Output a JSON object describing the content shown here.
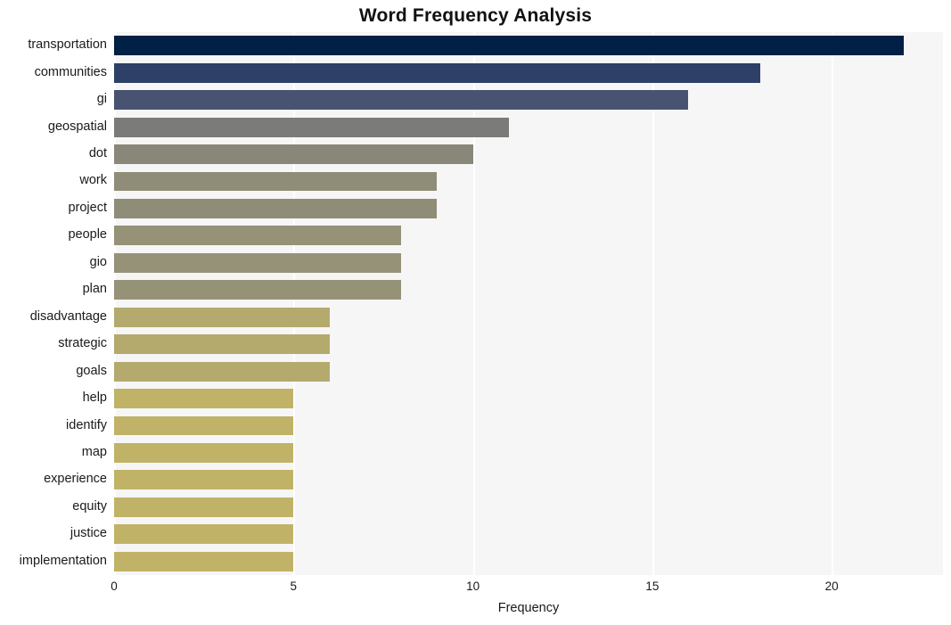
{
  "chart_data": {
    "type": "bar",
    "orientation": "horizontal",
    "title": "Word Frequency Analysis",
    "xlabel": "Frequency",
    "ylabel": "",
    "xlim": [
      0,
      23.1
    ],
    "xticks": [
      0,
      5,
      10,
      15,
      20
    ],
    "xticklabels": [
      "0",
      "5",
      "10",
      "15",
      "20"
    ],
    "grid": true,
    "grid_axis": "x",
    "grid_color": "#ffffff",
    "plot_background": "#f6f6f7",
    "legend": "none",
    "categories": [
      "transportation",
      "communities",
      "gi",
      "geospatial",
      "dot",
      "work",
      "project",
      "people",
      "gio",
      "plan",
      "disadvantage",
      "strategic",
      "goals",
      "help",
      "identify",
      "map",
      "experience",
      "equity",
      "justice",
      "implementation"
    ],
    "values": [
      22,
      18,
      16,
      11,
      10,
      9,
      9,
      8,
      8,
      8,
      6,
      6,
      6,
      5,
      5,
      5,
      5,
      5,
      5,
      5
    ],
    "bar_colors": [
      "#012045",
      "#2e4068",
      "#485271",
      "#7b7b79",
      "#888779",
      "#8f8c78",
      "#8f8c78",
      "#969278",
      "#969278",
      "#969278",
      "#b4aa6e",
      "#b4aa6e",
      "#b4aa6e",
      "#c0b367",
      "#c0b367",
      "#c0b367",
      "#c0b367",
      "#c0b367",
      "#c0b367",
      "#c0b367"
    ]
  }
}
